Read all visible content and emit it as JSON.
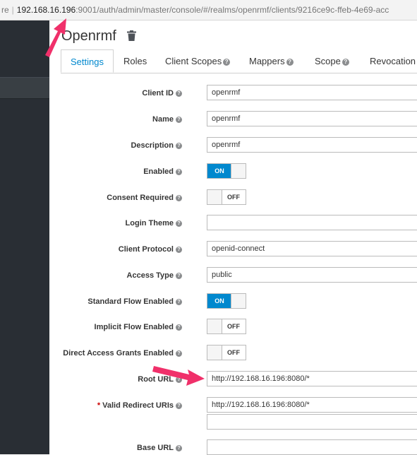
{
  "browser": {
    "url_prefix": "re",
    "url_host": "192.168.16.196",
    "url_path": ":9001/auth/admin/master/console/#/realms/openrmf/clients/9216ce9c-ffeb-4e69-acc"
  },
  "client": {
    "title": "Openrmf"
  },
  "tabs": [
    {
      "label": "Settings"
    },
    {
      "label": "Roles"
    },
    {
      "label": "Client Scopes"
    },
    {
      "label": "Mappers"
    },
    {
      "label": "Scope"
    },
    {
      "label": "Revocation"
    }
  ],
  "form": {
    "client_id": {
      "label": "Client ID",
      "value": "openrmf"
    },
    "name": {
      "label": "Name",
      "value": "openrmf"
    },
    "description": {
      "label": "Description",
      "value": "openrmf"
    },
    "enabled": {
      "label": "Enabled",
      "state": "ON"
    },
    "consent_required": {
      "label": "Consent Required",
      "state": "OFF"
    },
    "login_theme": {
      "label": "Login Theme",
      "value": ""
    },
    "client_protocol": {
      "label": "Client Protocol",
      "value": "openid-connect"
    },
    "access_type": {
      "label": "Access Type",
      "value": "public"
    },
    "standard_flow": {
      "label": "Standard Flow Enabled",
      "state": "ON"
    },
    "implicit_flow": {
      "label": "Implicit Flow Enabled",
      "state": "OFF"
    },
    "direct_access": {
      "label": "Direct Access Grants Enabled",
      "state": "OFF"
    },
    "root_url": {
      "label": "Root URL",
      "value": "http://192.168.16.196:8080/*"
    },
    "valid_redirect": {
      "label": "Valid Redirect URIs",
      "required_mark": "*",
      "value": "http://192.168.16.196:8080/*",
      "value2": ""
    },
    "base_url": {
      "label": "Base URL",
      "value": ""
    }
  },
  "colors": {
    "accent": "#0088ce",
    "annotation_arrow": "#f0306a",
    "sidebar": "#292e34"
  },
  "icons": {
    "help": "question-circle-icon",
    "delete": "trash-icon"
  }
}
